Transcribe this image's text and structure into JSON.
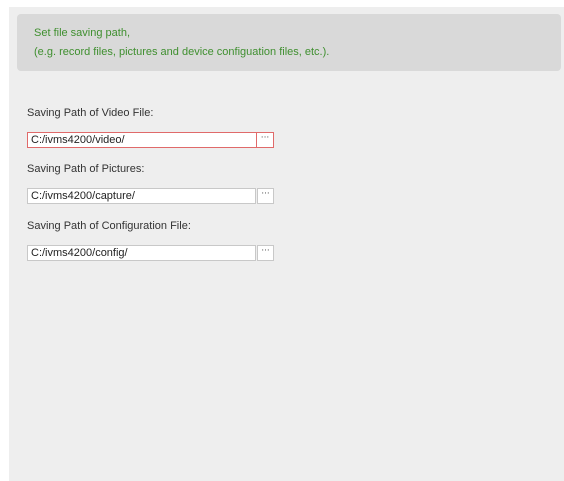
{
  "info": {
    "line1": "Set file saving path,",
    "line2": "(e.g. record files, pictures and device configuation files, etc.)."
  },
  "fields": [
    {
      "label": "Saving Path of Video File:",
      "value": "C:/ivms4200/video/",
      "browse_label": "···",
      "focused": true
    },
    {
      "label": "Saving Path of Pictures:",
      "value": "C:/ivms4200/capture/",
      "browse_label": "···",
      "focused": false
    },
    {
      "label": "Saving Path of Configuration File:",
      "value": "C:/ivms4200/config/",
      "browse_label": "···",
      "focused": false
    }
  ],
  "colors": {
    "info_text": "#3f8f2f",
    "focus_border": "#e06a6a",
    "panel_bg": "#eeeeee",
    "info_bg": "#d9d9d9"
  }
}
